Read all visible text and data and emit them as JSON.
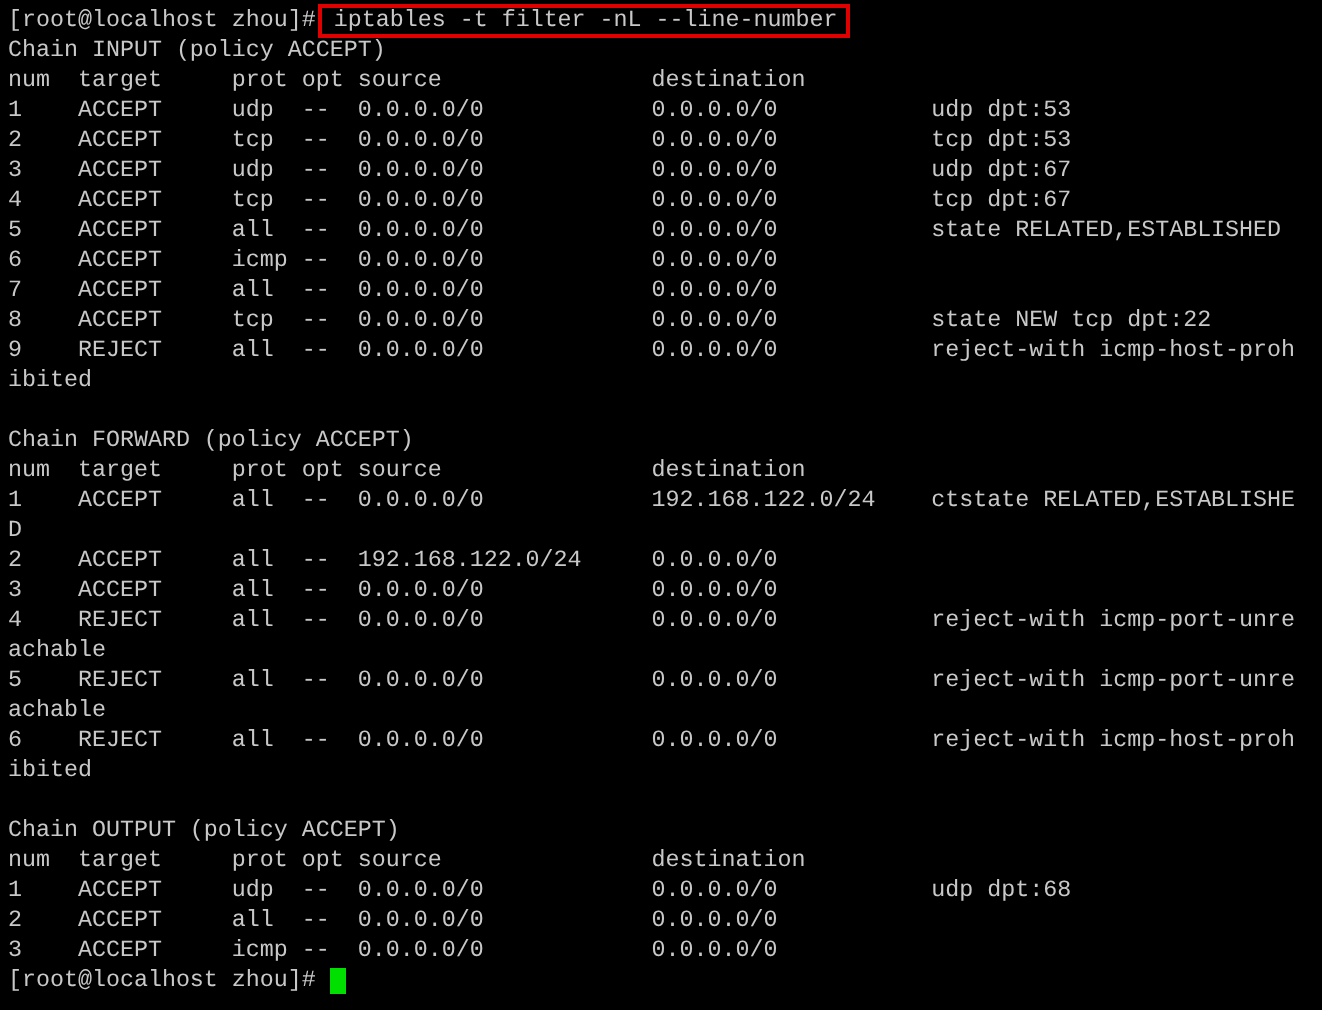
{
  "terminal": {
    "lines": [
      {
        "kind": "prompt",
        "prompt": "[root@localhost zhou]#",
        "command": "iptables -t filter -nL --line-number",
        "boxed": true,
        "cursor": false
      },
      {
        "kind": "text",
        "text": "Chain INPUT (policy ACCEPT)"
      },
      {
        "kind": "text",
        "text": "num  target     prot opt source               destination"
      },
      {
        "kind": "text",
        "text": "1    ACCEPT     udp  --  0.0.0.0/0            0.0.0.0/0           udp dpt:53"
      },
      {
        "kind": "text",
        "text": "2    ACCEPT     tcp  --  0.0.0.0/0            0.0.0.0/0           tcp dpt:53"
      },
      {
        "kind": "text",
        "text": "3    ACCEPT     udp  --  0.0.0.0/0            0.0.0.0/0           udp dpt:67"
      },
      {
        "kind": "text",
        "text": "4    ACCEPT     tcp  --  0.0.0.0/0            0.0.0.0/0           tcp dpt:67"
      },
      {
        "kind": "text",
        "text": "5    ACCEPT     all  --  0.0.0.0/0            0.0.0.0/0           state RELATED,ESTABLISHED"
      },
      {
        "kind": "text",
        "text": "6    ACCEPT     icmp --  0.0.0.0/0            0.0.0.0/0"
      },
      {
        "kind": "text",
        "text": "7    ACCEPT     all  --  0.0.0.0/0            0.0.0.0/0"
      },
      {
        "kind": "text",
        "text": "8    ACCEPT     tcp  --  0.0.0.0/0            0.0.0.0/0           state NEW tcp dpt:22"
      },
      {
        "kind": "text",
        "text": "9    REJECT     all  --  0.0.0.0/0            0.0.0.0/0           reject-with icmp-host-proh"
      },
      {
        "kind": "text",
        "text": "ibited"
      },
      {
        "kind": "blank"
      },
      {
        "kind": "text",
        "text": "Chain FORWARD (policy ACCEPT)"
      },
      {
        "kind": "text",
        "text": "num  target     prot opt source               destination"
      },
      {
        "kind": "text",
        "text": "1    ACCEPT     all  --  0.0.0.0/0            192.168.122.0/24    ctstate RELATED,ESTABLISHE"
      },
      {
        "kind": "text",
        "text": "D"
      },
      {
        "kind": "text",
        "text": "2    ACCEPT     all  --  192.168.122.0/24     0.0.0.0/0"
      },
      {
        "kind": "text",
        "text": "3    ACCEPT     all  --  0.0.0.0/0            0.0.0.0/0"
      },
      {
        "kind": "text",
        "text": "4    REJECT     all  --  0.0.0.0/0            0.0.0.0/0           reject-with icmp-port-unre"
      },
      {
        "kind": "text",
        "text": "achable"
      },
      {
        "kind": "text",
        "text": "5    REJECT     all  --  0.0.0.0/0            0.0.0.0/0           reject-with icmp-port-unre"
      },
      {
        "kind": "text",
        "text": "achable"
      },
      {
        "kind": "text",
        "text": "6    REJECT     all  --  0.0.0.0/0            0.0.0.0/0           reject-with icmp-host-proh"
      },
      {
        "kind": "text",
        "text": "ibited"
      },
      {
        "kind": "blank"
      },
      {
        "kind": "text",
        "text": "Chain OUTPUT (policy ACCEPT)"
      },
      {
        "kind": "text",
        "text": "num  target     prot opt source               destination"
      },
      {
        "kind": "text",
        "text": "1    ACCEPT     udp  --  0.0.0.0/0            0.0.0.0/0           udp dpt:68"
      },
      {
        "kind": "text",
        "text": "2    ACCEPT     all  --  0.0.0.0/0            0.0.0.0/0"
      },
      {
        "kind": "text",
        "text": "3    ACCEPT     icmp --  0.0.0.0/0            0.0.0.0/0"
      },
      {
        "kind": "prompt",
        "prompt": "[root@localhost zhou]#",
        "cursor": true
      }
    ]
  }
}
